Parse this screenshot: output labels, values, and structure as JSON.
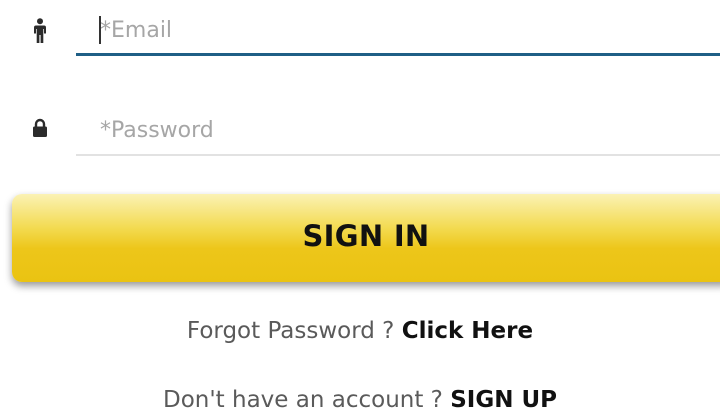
{
  "email_field": {
    "placeholder": "*Email",
    "value": "",
    "icon": "person-icon"
  },
  "password_field": {
    "placeholder": "*Password",
    "value": "",
    "icon": "lock-icon"
  },
  "signin_button": {
    "label": "SIGN IN"
  },
  "forgot": {
    "text": "Forgot Password ? ",
    "link_label": "Click Here"
  },
  "signup": {
    "text": "Don't have an account ? ",
    "link_label": "SIGN UP"
  },
  "colors": {
    "focused_underline": "#1f5f86",
    "underline": "#e2e2e2",
    "button": "#edc61a",
    "placeholder": "#a6a6a6",
    "link": "#111111"
  }
}
